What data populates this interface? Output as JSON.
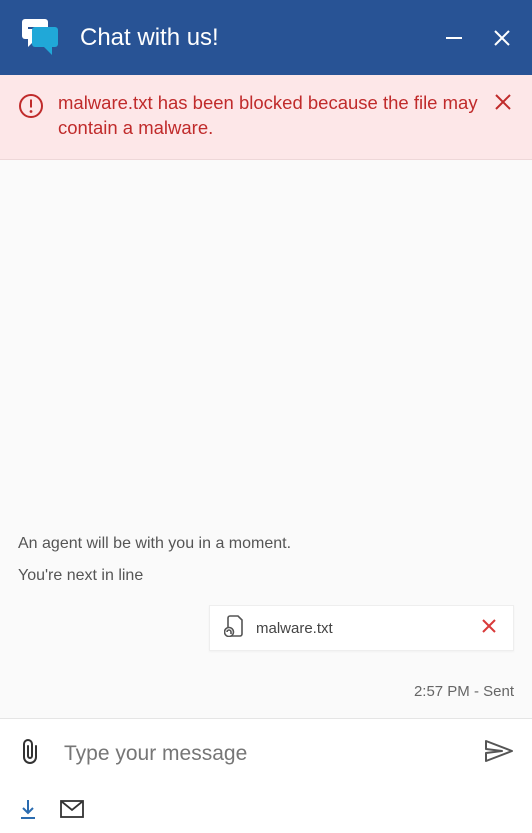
{
  "header": {
    "title": "Chat with us!"
  },
  "alert": {
    "text": "malware.txt has been blocked because the file may contain a malware."
  },
  "status": {
    "agent_msg": "An agent will be with you in a moment.",
    "queue_msg": "You're next in line"
  },
  "attachment": {
    "file_name": "malware.txt"
  },
  "meta": {
    "timestamp": "2:57 PM",
    "status": "Sent",
    "combined": "2:57 PM - Sent"
  },
  "composer": {
    "placeholder": "Type your message"
  },
  "colors": {
    "header_bg": "#285395",
    "alert_bg": "#fde7e8",
    "alert_text": "#c02b2b",
    "remove_red": "#d83b3b"
  }
}
